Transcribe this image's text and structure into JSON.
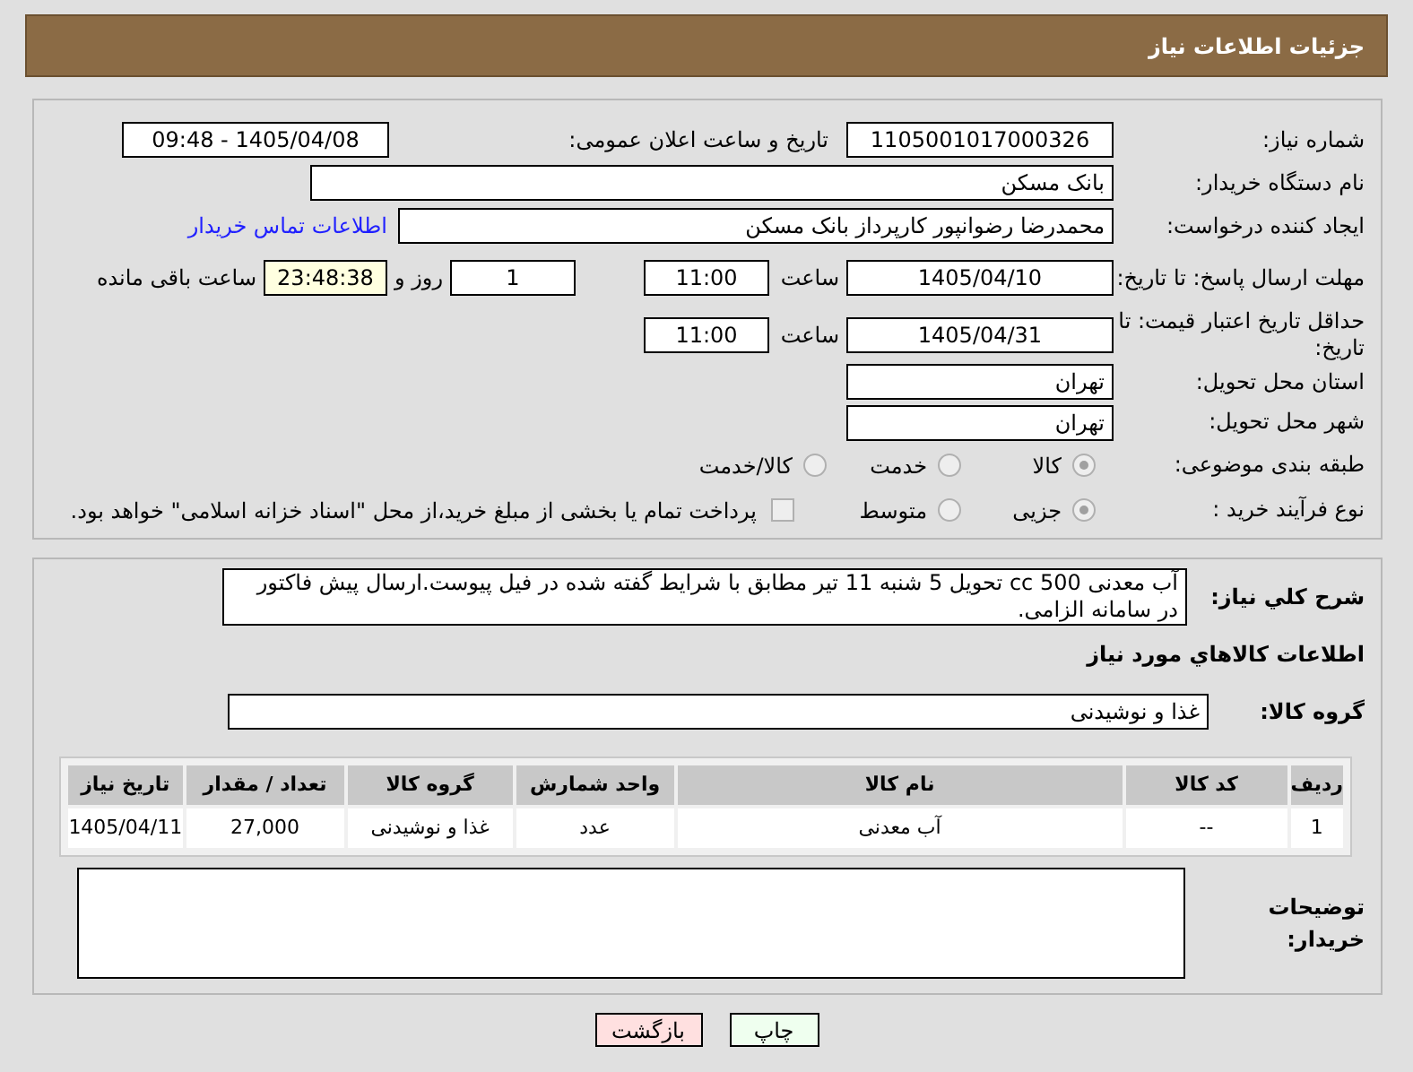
{
  "header": {
    "title": "جزئیات اطلاعات نیاز"
  },
  "need_number": {
    "label": "شماره نیاز:",
    "value": "1105001017000326"
  },
  "announce": {
    "label": "تاریخ و ساعت اعلان عمومی:",
    "value": "1405/04/08 - 09:48"
  },
  "buyer": {
    "label": "نام دستگاه خریدار:",
    "value": "بانک مسکن"
  },
  "creator": {
    "label": "ایجاد کننده درخواست:",
    "value": "محمدرضا رضوانپور کارپرداز بانک مسکن",
    "link": "اطلاعات تماس خریدار"
  },
  "deadline": {
    "label": "مهلت ارسال پاسخ: تا تاریخ:",
    "date": "1405/04/10",
    "time_label": "ساعت",
    "time": "11:00",
    "days": "1",
    "days_label": "روز و",
    "remaining": "23:48:38",
    "remaining_label": "ساعت باقی مانده"
  },
  "validity": {
    "label": "حداقل تاریخ اعتبار قیمت: تا تاریخ:",
    "date": "1405/04/31",
    "time_label": "ساعت",
    "time": "11:00"
  },
  "province": {
    "label": "استان محل تحویل:",
    "value": "تهران"
  },
  "city": {
    "label": "شهر محل تحویل:",
    "value": "تهران"
  },
  "category": {
    "label": "طبقه بندی موضوعی:",
    "options": [
      {
        "label": "کالا",
        "selected": true
      },
      {
        "label": "خدمت",
        "selected": false
      },
      {
        "label": "کالا/خدمت",
        "selected": false
      }
    ]
  },
  "process": {
    "label": "نوع فرآیند خرید :",
    "options": [
      {
        "label": "جزیی",
        "selected": true
      },
      {
        "label": "متوسط",
        "selected": false
      }
    ],
    "payment": {
      "label": "پرداخت تمام یا بخشی از مبلغ خرید،از محل \"اسناد خزانه اسلامی\" خواهد بود.",
      "checked": false
    }
  },
  "description": {
    "label": "شرح کلي نیاز:",
    "value": "آب معدنی 500 cc تحویل 5 شنبه 11 تیر مطابق با شرایط گفته شده در فیل پیوست.ارسال پیش فاکتور در سامانه الزامی."
  },
  "goods_title": "اطلاعات کالاهاي مورد نیاز",
  "goods_group": {
    "label": "گروه کالا:",
    "value": "غذا و نوشیدنی"
  },
  "table": {
    "columns": [
      "ردیف",
      "کد کالا",
      "نام کالا",
      "واحد شمارش",
      "گروه کالا",
      "تعداد / مقدار",
      "تاریخ نیاز"
    ],
    "rows": [
      [
        "1",
        "--",
        "آب معدنی",
        "عدد",
        "غذا و نوشیدنی",
        "27,000",
        "1405/04/11"
      ]
    ]
  },
  "buyer_notes": {
    "label": "توضیحات خریدار:"
  },
  "buttons": [
    {
      "label": "چاپ",
      "kind": "print"
    },
    {
      "label": "بازگشت",
      "kind": "back"
    }
  ]
}
